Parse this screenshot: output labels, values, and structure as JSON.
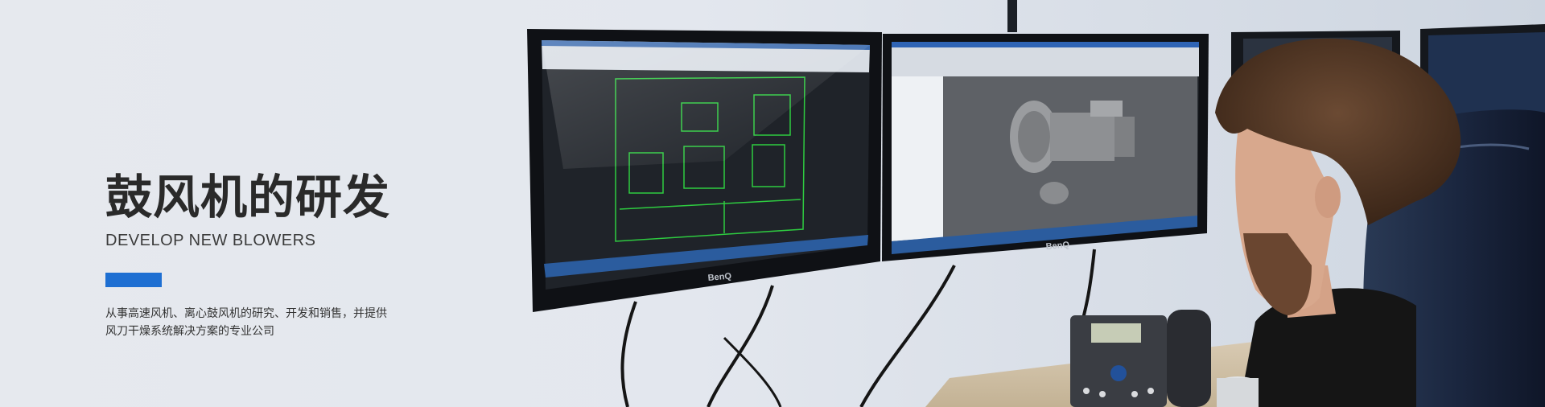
{
  "banner": {
    "title": "鼓风机的研发",
    "subtitle": "DEVELOP NEW BLOWERS",
    "description_lines": [
      "从事高速风机、离心鼓风机的研究、开发和销售，并提供",
      "风刀干燥系统解决方案的专业公司"
    ],
    "accent_color": "#1e6fd2"
  },
  "photo": {
    "left_monitor": {
      "brand": "BenQ"
    },
    "right_monitor": {
      "brand": "BenQ"
    }
  }
}
